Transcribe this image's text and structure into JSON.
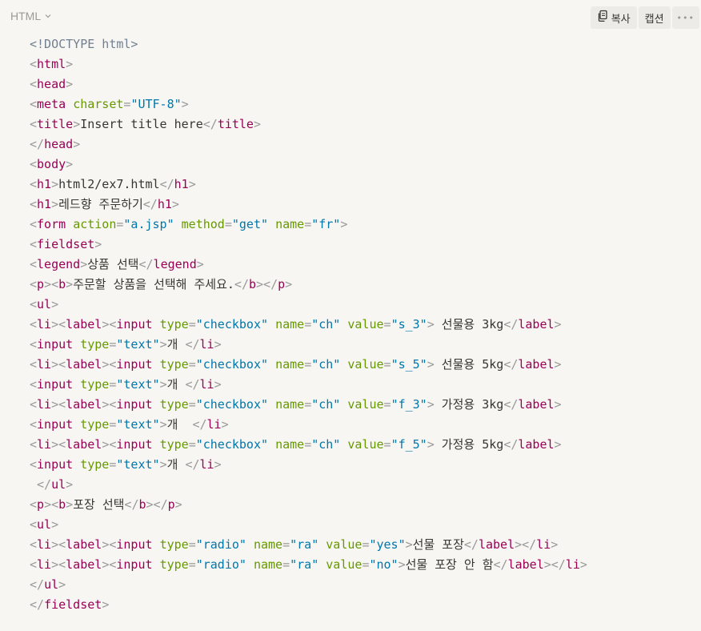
{
  "header": {
    "language": "HTML",
    "copy_label": "복사",
    "caption_label": "캡션",
    "more_label": "•••"
  },
  "colors": {
    "background": "#f7f6f3",
    "tag": "#990055",
    "attr_name": "#669900",
    "attr_value": "#0077aa",
    "punctuation": "#999999",
    "text": "#37352f"
  },
  "code_lines": [
    [
      [
        "doctype",
        "<!DOCTYPE html>"
      ]
    ],
    [
      [
        "punct",
        "<"
      ],
      [
        "tag",
        "html"
      ],
      [
        "punct",
        ">"
      ]
    ],
    [
      [
        "punct",
        "<"
      ],
      [
        "tag",
        "head"
      ],
      [
        "punct",
        ">"
      ]
    ],
    [
      [
        "punct",
        "<"
      ],
      [
        "tag",
        "meta"
      ],
      [
        "text",
        " "
      ],
      [
        "attr",
        "charset"
      ],
      [
        "punct",
        "="
      ],
      [
        "str",
        "\"UTF-8\""
      ],
      [
        "punct",
        ">"
      ]
    ],
    [
      [
        "punct",
        "<"
      ],
      [
        "tag",
        "title"
      ],
      [
        "punct",
        ">"
      ],
      [
        "text",
        "Insert title here"
      ],
      [
        "punct",
        "</"
      ],
      [
        "tag",
        "title"
      ],
      [
        "punct",
        ">"
      ]
    ],
    [
      [
        "punct",
        "</"
      ],
      [
        "tag",
        "head"
      ],
      [
        "punct",
        ">"
      ]
    ],
    [
      [
        "punct",
        "<"
      ],
      [
        "tag",
        "body"
      ],
      [
        "punct",
        ">"
      ]
    ],
    [
      [
        "punct",
        "<"
      ],
      [
        "tag",
        "h1"
      ],
      [
        "punct",
        ">"
      ],
      [
        "text",
        "html2/ex7.html"
      ],
      [
        "punct",
        "</"
      ],
      [
        "tag",
        "h1"
      ],
      [
        "punct",
        ">"
      ]
    ],
    [
      [
        "punct",
        "<"
      ],
      [
        "tag",
        "h1"
      ],
      [
        "punct",
        ">"
      ],
      [
        "text",
        "레드향 주문하기"
      ],
      [
        "punct",
        "</"
      ],
      [
        "tag",
        "h1"
      ],
      [
        "punct",
        ">"
      ]
    ],
    [
      [
        "punct",
        "<"
      ],
      [
        "tag",
        "form"
      ],
      [
        "text",
        " "
      ],
      [
        "attr",
        "action"
      ],
      [
        "punct",
        "="
      ],
      [
        "str",
        "\"a.jsp\""
      ],
      [
        "text",
        " "
      ],
      [
        "attr",
        "method"
      ],
      [
        "punct",
        "="
      ],
      [
        "str",
        "\"get\""
      ],
      [
        "text",
        " "
      ],
      [
        "attr",
        "name"
      ],
      [
        "punct",
        "="
      ],
      [
        "str",
        "\"fr\""
      ],
      [
        "punct",
        ">"
      ]
    ],
    [
      [
        "punct",
        "<"
      ],
      [
        "tag",
        "fieldset"
      ],
      [
        "punct",
        ">"
      ]
    ],
    [
      [
        "punct",
        "<"
      ],
      [
        "tag",
        "legend"
      ],
      [
        "punct",
        ">"
      ],
      [
        "text",
        "상품 선택"
      ],
      [
        "punct",
        "</"
      ],
      [
        "tag",
        "legend"
      ],
      [
        "punct",
        ">"
      ]
    ],
    [
      [
        "punct",
        "<"
      ],
      [
        "tag",
        "p"
      ],
      [
        "punct",
        "><"
      ],
      [
        "tag",
        "b"
      ],
      [
        "punct",
        ">"
      ],
      [
        "text",
        "주문할 상품을 선택해 주세요."
      ],
      [
        "punct",
        "</"
      ],
      [
        "tag",
        "b"
      ],
      [
        "punct",
        "></"
      ],
      [
        "tag",
        "p"
      ],
      [
        "punct",
        ">"
      ]
    ],
    [
      [
        "punct",
        "<"
      ],
      [
        "tag",
        "ul"
      ],
      [
        "punct",
        ">"
      ]
    ],
    [
      [
        "punct",
        "<"
      ],
      [
        "tag",
        "li"
      ],
      [
        "punct",
        "><"
      ],
      [
        "tag",
        "label"
      ],
      [
        "punct",
        "><"
      ],
      [
        "tag",
        "input"
      ],
      [
        "text",
        " "
      ],
      [
        "attr",
        "type"
      ],
      [
        "punct",
        "="
      ],
      [
        "str",
        "\"checkbox\""
      ],
      [
        "text",
        " "
      ],
      [
        "attr",
        "name"
      ],
      [
        "punct",
        "="
      ],
      [
        "str",
        "\"ch\""
      ],
      [
        "text",
        " "
      ],
      [
        "attr",
        "value"
      ],
      [
        "punct",
        "="
      ],
      [
        "str",
        "\"s_3\""
      ],
      [
        "punct",
        ">"
      ],
      [
        "text",
        " 선물용 3kg"
      ],
      [
        "punct",
        "</"
      ],
      [
        "tag",
        "label"
      ],
      [
        "punct",
        ">"
      ]
    ],
    [
      [
        "punct",
        "<"
      ],
      [
        "tag",
        "input"
      ],
      [
        "text",
        " "
      ],
      [
        "attr",
        "type"
      ],
      [
        "punct",
        "="
      ],
      [
        "str",
        "\"text\""
      ],
      [
        "punct",
        ">"
      ],
      [
        "text",
        "개 "
      ],
      [
        "punct",
        "</"
      ],
      [
        "tag",
        "li"
      ],
      [
        "punct",
        ">"
      ]
    ],
    [
      [
        "punct",
        "<"
      ],
      [
        "tag",
        "li"
      ],
      [
        "punct",
        "><"
      ],
      [
        "tag",
        "label"
      ],
      [
        "punct",
        "><"
      ],
      [
        "tag",
        "input"
      ],
      [
        "text",
        " "
      ],
      [
        "attr",
        "type"
      ],
      [
        "punct",
        "="
      ],
      [
        "str",
        "\"checkbox\""
      ],
      [
        "text",
        " "
      ],
      [
        "attr",
        "name"
      ],
      [
        "punct",
        "="
      ],
      [
        "str",
        "\"ch\""
      ],
      [
        "text",
        " "
      ],
      [
        "attr",
        "value"
      ],
      [
        "punct",
        "="
      ],
      [
        "str",
        "\"s_5\""
      ],
      [
        "punct",
        ">"
      ],
      [
        "text",
        " 선물용 5kg"
      ],
      [
        "punct",
        "</"
      ],
      [
        "tag",
        "label"
      ],
      [
        "punct",
        ">"
      ]
    ],
    [
      [
        "punct",
        "<"
      ],
      [
        "tag",
        "input"
      ],
      [
        "text",
        " "
      ],
      [
        "attr",
        "type"
      ],
      [
        "punct",
        "="
      ],
      [
        "str",
        "\"text\""
      ],
      [
        "punct",
        ">"
      ],
      [
        "text",
        "개 "
      ],
      [
        "punct",
        "</"
      ],
      [
        "tag",
        "li"
      ],
      [
        "punct",
        ">"
      ]
    ],
    [
      [
        "punct",
        "<"
      ],
      [
        "tag",
        "li"
      ],
      [
        "punct",
        "><"
      ],
      [
        "tag",
        "label"
      ],
      [
        "punct",
        "><"
      ],
      [
        "tag",
        "input"
      ],
      [
        "text",
        " "
      ],
      [
        "attr",
        "type"
      ],
      [
        "punct",
        "="
      ],
      [
        "str",
        "\"checkbox\""
      ],
      [
        "text",
        " "
      ],
      [
        "attr",
        "name"
      ],
      [
        "punct",
        "="
      ],
      [
        "str",
        "\"ch\""
      ],
      [
        "text",
        " "
      ],
      [
        "attr",
        "value"
      ],
      [
        "punct",
        "="
      ],
      [
        "str",
        "\"f_3\""
      ],
      [
        "punct",
        ">"
      ],
      [
        "text",
        " 가정용 3kg"
      ],
      [
        "punct",
        "</"
      ],
      [
        "tag",
        "label"
      ],
      [
        "punct",
        ">"
      ]
    ],
    [
      [
        "punct",
        "<"
      ],
      [
        "tag",
        "input"
      ],
      [
        "text",
        " "
      ],
      [
        "attr",
        "type"
      ],
      [
        "punct",
        "="
      ],
      [
        "str",
        "\"text\""
      ],
      [
        "punct",
        ">"
      ],
      [
        "text",
        "개  "
      ],
      [
        "punct",
        "</"
      ],
      [
        "tag",
        "li"
      ],
      [
        "punct",
        ">"
      ]
    ],
    [
      [
        "punct",
        "<"
      ],
      [
        "tag",
        "li"
      ],
      [
        "punct",
        "><"
      ],
      [
        "tag",
        "label"
      ],
      [
        "punct",
        "><"
      ],
      [
        "tag",
        "input"
      ],
      [
        "text",
        " "
      ],
      [
        "attr",
        "type"
      ],
      [
        "punct",
        "="
      ],
      [
        "str",
        "\"checkbox\""
      ],
      [
        "text",
        " "
      ],
      [
        "attr",
        "name"
      ],
      [
        "punct",
        "="
      ],
      [
        "str",
        "\"ch\""
      ],
      [
        "text",
        " "
      ],
      [
        "attr",
        "value"
      ],
      [
        "punct",
        "="
      ],
      [
        "str",
        "\"f_5\""
      ],
      [
        "punct",
        ">"
      ],
      [
        "text",
        " 가정용 5kg"
      ],
      [
        "punct",
        "</"
      ],
      [
        "tag",
        "label"
      ],
      [
        "punct",
        ">"
      ]
    ],
    [
      [
        "punct",
        "<"
      ],
      [
        "tag",
        "input"
      ],
      [
        "text",
        " "
      ],
      [
        "attr",
        "type"
      ],
      [
        "punct",
        "="
      ],
      [
        "str",
        "\"text\""
      ],
      [
        "punct",
        ">"
      ],
      [
        "text",
        "개 "
      ],
      [
        "punct",
        "</"
      ],
      [
        "tag",
        "li"
      ],
      [
        "punct",
        ">"
      ]
    ],
    [
      [
        "text",
        " "
      ],
      [
        "punct",
        "</"
      ],
      [
        "tag",
        "ul"
      ],
      [
        "punct",
        ">"
      ]
    ],
    [
      [
        "punct",
        "<"
      ],
      [
        "tag",
        "p"
      ],
      [
        "punct",
        "><"
      ],
      [
        "tag",
        "b"
      ],
      [
        "punct",
        ">"
      ],
      [
        "text",
        "포장 선택"
      ],
      [
        "punct",
        "</"
      ],
      [
        "tag",
        "b"
      ],
      [
        "punct",
        "></"
      ],
      [
        "tag",
        "p"
      ],
      [
        "punct",
        ">"
      ]
    ],
    [
      [
        "punct",
        "<"
      ],
      [
        "tag",
        "ul"
      ],
      [
        "punct",
        ">"
      ]
    ],
    [
      [
        "punct",
        "<"
      ],
      [
        "tag",
        "li"
      ],
      [
        "punct",
        "><"
      ],
      [
        "tag",
        "label"
      ],
      [
        "punct",
        "><"
      ],
      [
        "tag",
        "input"
      ],
      [
        "text",
        " "
      ],
      [
        "attr",
        "type"
      ],
      [
        "punct",
        "="
      ],
      [
        "str",
        "\"radio\""
      ],
      [
        "text",
        " "
      ],
      [
        "attr",
        "name"
      ],
      [
        "punct",
        "="
      ],
      [
        "str",
        "\"ra\""
      ],
      [
        "text",
        " "
      ],
      [
        "attr",
        "value"
      ],
      [
        "punct",
        "="
      ],
      [
        "str",
        "\"yes\""
      ],
      [
        "punct",
        ">"
      ],
      [
        "text",
        "선물 포장"
      ],
      [
        "punct",
        "</"
      ],
      [
        "tag",
        "label"
      ],
      [
        "punct",
        "></"
      ],
      [
        "tag",
        "li"
      ],
      [
        "punct",
        ">"
      ]
    ],
    [
      [
        "punct",
        "<"
      ],
      [
        "tag",
        "li"
      ],
      [
        "punct",
        "><"
      ],
      [
        "tag",
        "label"
      ],
      [
        "punct",
        "><"
      ],
      [
        "tag",
        "input"
      ],
      [
        "text",
        " "
      ],
      [
        "attr",
        "type"
      ],
      [
        "punct",
        "="
      ],
      [
        "str",
        "\"radio\""
      ],
      [
        "text",
        " "
      ],
      [
        "attr",
        "name"
      ],
      [
        "punct",
        "="
      ],
      [
        "str",
        "\"ra\""
      ],
      [
        "text",
        " "
      ],
      [
        "attr",
        "value"
      ],
      [
        "punct",
        "="
      ],
      [
        "str",
        "\"no\""
      ],
      [
        "punct",
        ">"
      ],
      [
        "text",
        "선물 포장 안 함"
      ],
      [
        "punct",
        "</"
      ],
      [
        "tag",
        "label"
      ],
      [
        "punct",
        "></"
      ],
      [
        "tag",
        "li"
      ],
      [
        "punct",
        ">"
      ]
    ],
    [
      [
        "punct",
        "</"
      ],
      [
        "tag",
        "ul"
      ],
      [
        "punct",
        ">"
      ]
    ],
    [
      [
        "punct",
        "</"
      ],
      [
        "tag",
        "fieldset"
      ],
      [
        "punct",
        ">"
      ]
    ]
  ]
}
